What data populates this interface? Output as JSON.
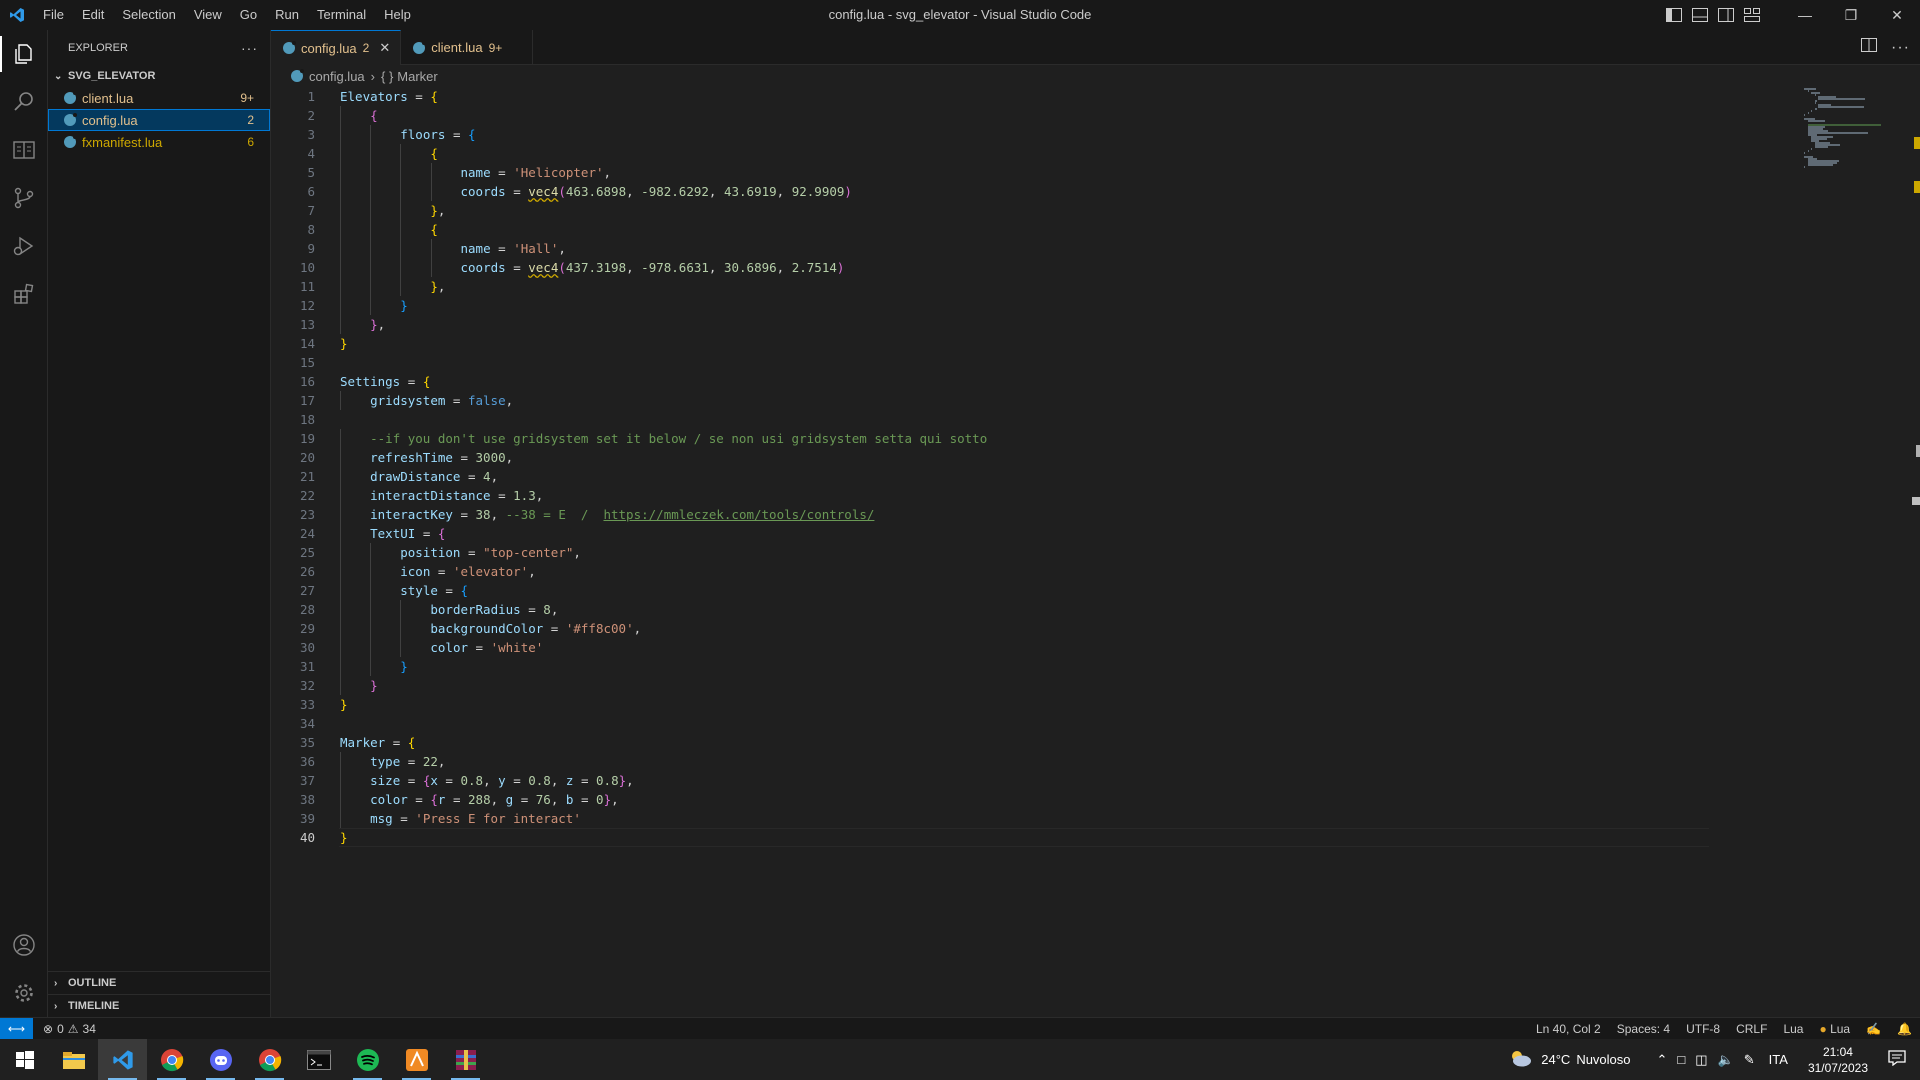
{
  "window": {
    "title": "config.lua - svg_elevator - Visual Studio Code",
    "menu": [
      "File",
      "Edit",
      "Selection",
      "View",
      "Go",
      "Run",
      "Terminal",
      "Help"
    ]
  },
  "sidebar": {
    "header": "EXPLORER",
    "folder": "SVG_ELEVATOR",
    "files": [
      {
        "name": "client.lua",
        "badge": "9+",
        "selected": false
      },
      {
        "name": "config.lua",
        "badge": "2",
        "selected": true
      },
      {
        "name": "fxmanifest.lua",
        "badge": "6",
        "selected": false
      }
    ],
    "outline": "OUTLINE",
    "timeline": "TIMELINE"
  },
  "tabs": [
    {
      "name": "config.lua",
      "badge": "2",
      "active": true
    },
    {
      "name": "client.lua",
      "badge": "9+",
      "active": false
    }
  ],
  "breadcrumb": {
    "file": "config.lua",
    "symbol": "Marker"
  },
  "editor": {
    "current_line": 40,
    "lines": [
      "Elevators = {",
      "    {",
      "        floors = {",
      "            {",
      "                name = 'Helicopter',",
      "                coords = vec4(463.6898, -982.6292, 43.6919, 92.9909)",
      "            },",
      "            {",
      "                name = 'Hall',",
      "                coords = vec4(437.3198, -978.6631, 30.6896, 2.7514)",
      "            },",
      "        }",
      "    },",
      "}",
      "",
      "Settings = {",
      "    gridsystem = false,",
      "",
      "    --if you don't use gridsystem set it below / se non usi gridsystem setta qui sotto",
      "    refreshTime = 3000,",
      "    drawDistance = 4,",
      "    interactDistance = 1.3,",
      "    interactKey = 38, --38 = E  /  https://mmleczek.com/tools/controls/",
      "    TextUI = {",
      "        position = \"top-center\",",
      "        icon = 'elevator',",
      "        style = {",
      "            borderRadius = 8,",
      "            backgroundColor = '#ff8c00',",
      "            color = 'white'",
      "        }",
      "    }",
      "}",
      "",
      "Marker = {",
      "    type = 22,",
      "    size = {x = 0.8, y = 0.8, z = 0.8},",
      "    color = {r = 288, g = 76, b = 0},",
      "    msg = 'Press E for interact'",
      "}"
    ]
  },
  "statusbar": {
    "errors": "0",
    "warnings": "34",
    "position": "Ln 40, Col 2",
    "spaces": "Spaces: 4",
    "encoding": "UTF-8",
    "eol": "CRLF",
    "language": "Lua",
    "language_badge": "Lua"
  },
  "taskbar": {
    "weather_temp": "24°C",
    "weather_desc": "Nuvoloso",
    "lang": "ITA",
    "time": "21:04",
    "date": "31/07/2023"
  },
  "colors": {
    "accent": "#0078d4",
    "warning": "#cca700",
    "modified": "#e2c08d"
  }
}
